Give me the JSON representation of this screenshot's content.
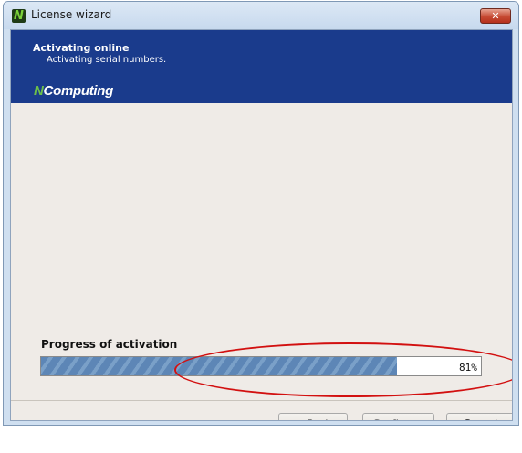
{
  "window": {
    "title": "License wizard",
    "close_glyph": "✕",
    "icon_letter": "N"
  },
  "banner": {
    "title": "Activating online",
    "subtitle": "Activating serial numbers.",
    "logo_n": "N",
    "logo_rest": "Computing",
    "brand_color": "#1a3b8c"
  },
  "progress": {
    "label": "Progress of activation",
    "value": 0.81,
    "percent_text": "81%"
  },
  "annotation": {
    "type": "red-ellipse",
    "color": "#d21010"
  },
  "buttons": {
    "back": "< Back",
    "confirm": "Confirm >",
    "cancel": "Cancel"
  }
}
